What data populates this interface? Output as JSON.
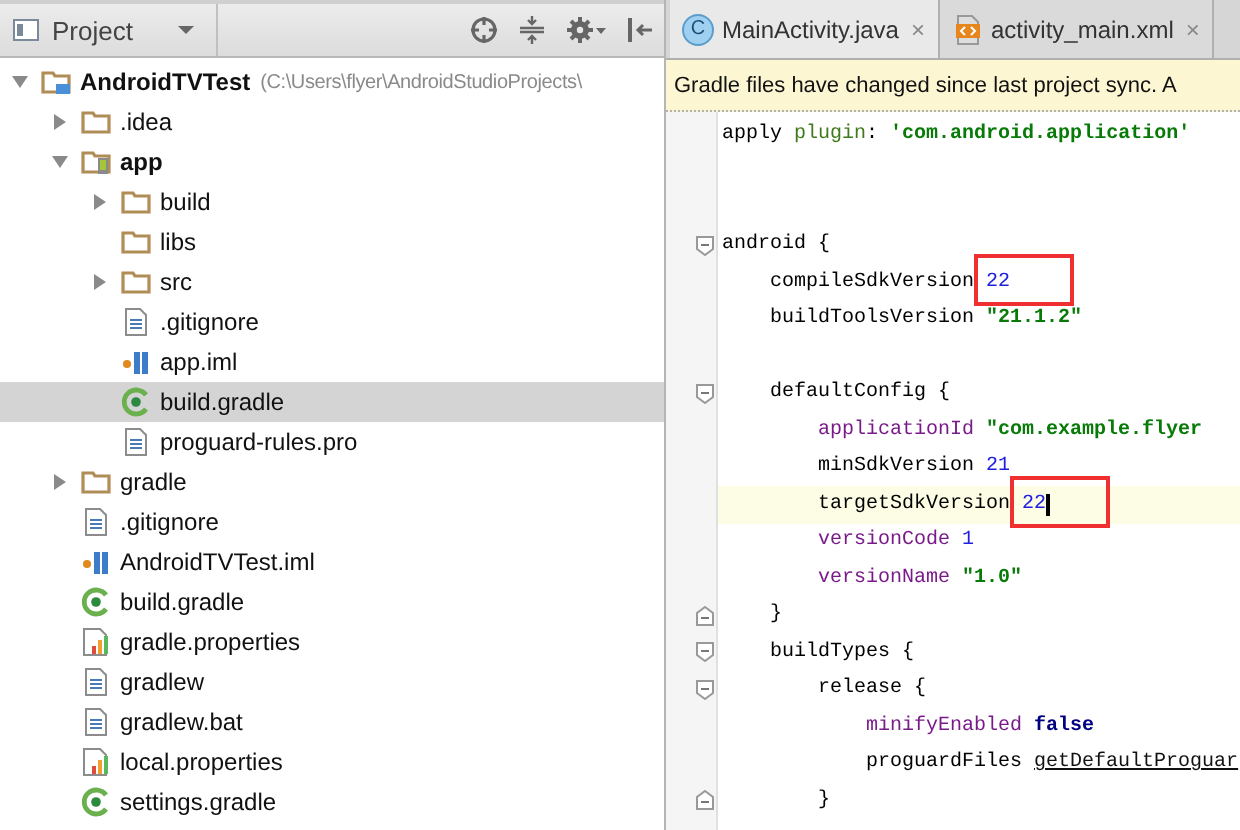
{
  "project_panel": {
    "title": "Project",
    "tree": [
      {
        "label": "AndroidTVTest",
        "path": "(C:\\Users\\flyer\\AndroidStudioProjects\\",
        "kind": "project",
        "expanded": true,
        "selected": false,
        "children": [
          {
            "label": ".idea",
            "kind": "folder",
            "expanded": false,
            "selected": false
          },
          {
            "label": "app",
            "kind": "module",
            "expanded": true,
            "selected": false,
            "children": [
              {
                "label": "build",
                "kind": "folder",
                "expanded": false,
                "selected": false
              },
              {
                "label": "libs",
                "kind": "folder",
                "selected": false
              },
              {
                "label": "src",
                "kind": "folder",
                "expanded": false,
                "selected": false
              },
              {
                "label": ".gitignore",
                "kind": "text",
                "selected": false
              },
              {
                "label": "app.iml",
                "kind": "iml",
                "selected": false
              },
              {
                "label": "build.gradle",
                "kind": "gradle",
                "selected": true
              },
              {
                "label": "proguard-rules.pro",
                "kind": "text",
                "selected": false
              }
            ]
          },
          {
            "label": "gradle",
            "kind": "folder",
            "expanded": false,
            "selected": false
          },
          {
            "label": ".gitignore",
            "kind": "text",
            "selected": false
          },
          {
            "label": "AndroidTVTest.iml",
            "kind": "iml",
            "selected": false
          },
          {
            "label": "build.gradle",
            "kind": "gradle",
            "selected": false
          },
          {
            "label": "gradle.properties",
            "kind": "properties",
            "selected": false
          },
          {
            "label": "gradlew",
            "kind": "text",
            "selected": false
          },
          {
            "label": "gradlew.bat",
            "kind": "text",
            "selected": false
          },
          {
            "label": "local.properties",
            "kind": "properties",
            "selected": false
          },
          {
            "label": "settings.gradle",
            "kind": "gradle",
            "selected": false
          }
        ]
      }
    ]
  },
  "editor": {
    "tabs": [
      {
        "label": "MainActivity.java",
        "kind": "class",
        "icon_text": "C",
        "close": "×",
        "selected": true
      },
      {
        "label": "activity_main.xml",
        "kind": "xml",
        "close": "×",
        "selected": false
      }
    ],
    "banner": "Gradle files have changed since last project sync. A",
    "lines": [
      {
        "kind": "code",
        "current": false,
        "tokens": [
          {
            "kind": "plain",
            "text": "apply "
          },
          {
            "kind": "keyword",
            "text": "plugin"
          },
          {
            "kind": "plain",
            "text": ": "
          },
          {
            "kind": "string",
            "text": "'com.android.application'"
          }
        ]
      },
      {
        "kind": "blank",
        "current": false
      },
      {
        "kind": "blank",
        "current": false
      },
      {
        "kind": "fold-start",
        "current": false,
        "tokens": [
          {
            "kind": "plain",
            "text": "android {"
          }
        ],
        "children": [
          {
            "kind": "code",
            "current": false,
            "tokens": [
              {
                "kind": "plain",
                "text": "compileSdkVersion "
              },
              {
                "kind": "number",
                "text": "22",
                "boxed": true
              }
            ]
          },
          {
            "kind": "code",
            "current": false,
            "tokens": [
              {
                "kind": "plain",
                "text": "buildToolsVersion "
              },
              {
                "kind": "string",
                "text": "\"21.1.2\""
              }
            ]
          },
          {
            "kind": "blank",
            "current": false
          },
          {
            "kind": "fold-start",
            "current": false,
            "tokens": [
              {
                "kind": "plain",
                "text": "defaultConfig {"
              }
            ],
            "children": [
              {
                "kind": "code",
                "current": false,
                "tokens": [
                  {
                    "kind": "property",
                    "text": "applicationId "
                  },
                  {
                    "kind": "string",
                    "text": "\"com.example.flyer"
                  }
                ]
              },
              {
                "kind": "code",
                "current": false,
                "tokens": [
                  {
                    "kind": "plain",
                    "text": "minSdkVersion "
                  },
                  {
                    "kind": "number",
                    "text": "21"
                  }
                ]
              },
              {
                "kind": "code",
                "current": true,
                "tokens": [
                  {
                    "kind": "plain",
                    "text": "targetSdkVersion "
                  },
                  {
                    "kind": "number",
                    "text": "22",
                    "boxed": true
                  }
                ]
              },
              {
                "kind": "code",
                "current": false,
                "tokens": [
                  {
                    "kind": "property",
                    "text": "versionCode "
                  },
                  {
                    "kind": "number",
                    "text": "1"
                  }
                ]
              },
              {
                "kind": "code",
                "current": false,
                "tokens": [
                  {
                    "kind": "property",
                    "text": "versionName "
                  },
                  {
                    "kind": "string",
                    "text": "\"1.0\""
                  }
                ]
              }
            ]
          },
          {
            "kind": "fold-end",
            "current": false,
            "tokens": [
              {
                "kind": "plain",
                "text": "}"
              }
            ]
          },
          {
            "kind": "fold-start",
            "current": false,
            "tokens": [
              {
                "kind": "plain",
                "text": "buildTypes {"
              }
            ],
            "children": [
              {
                "kind": "fold-start",
                "current": false,
                "tokens": [
                  {
                    "kind": "plain",
                    "text": "release {"
                  }
                ],
                "children": [
                  {
                    "kind": "code",
                    "current": false,
                    "tokens": [
                      {
                        "kind": "property",
                        "text": "minifyEnabled "
                      },
                      {
                        "kind": "bool",
                        "text": "false"
                      }
                    ]
                  },
                  {
                    "kind": "code",
                    "current": false,
                    "tokens": [
                      {
                        "kind": "plain",
                        "text": "proguardFiles "
                      },
                      {
                        "kind": "link",
                        "text": "getDefaultProguar"
                      }
                    ]
                  }
                ]
              },
              {
                "kind": "fold-end",
                "current": false,
                "tokens": [
                  {
                    "kind": "plain",
                    "text": "}"
                  }
                ]
              }
            ]
          }
        ]
      }
    ]
  }
}
